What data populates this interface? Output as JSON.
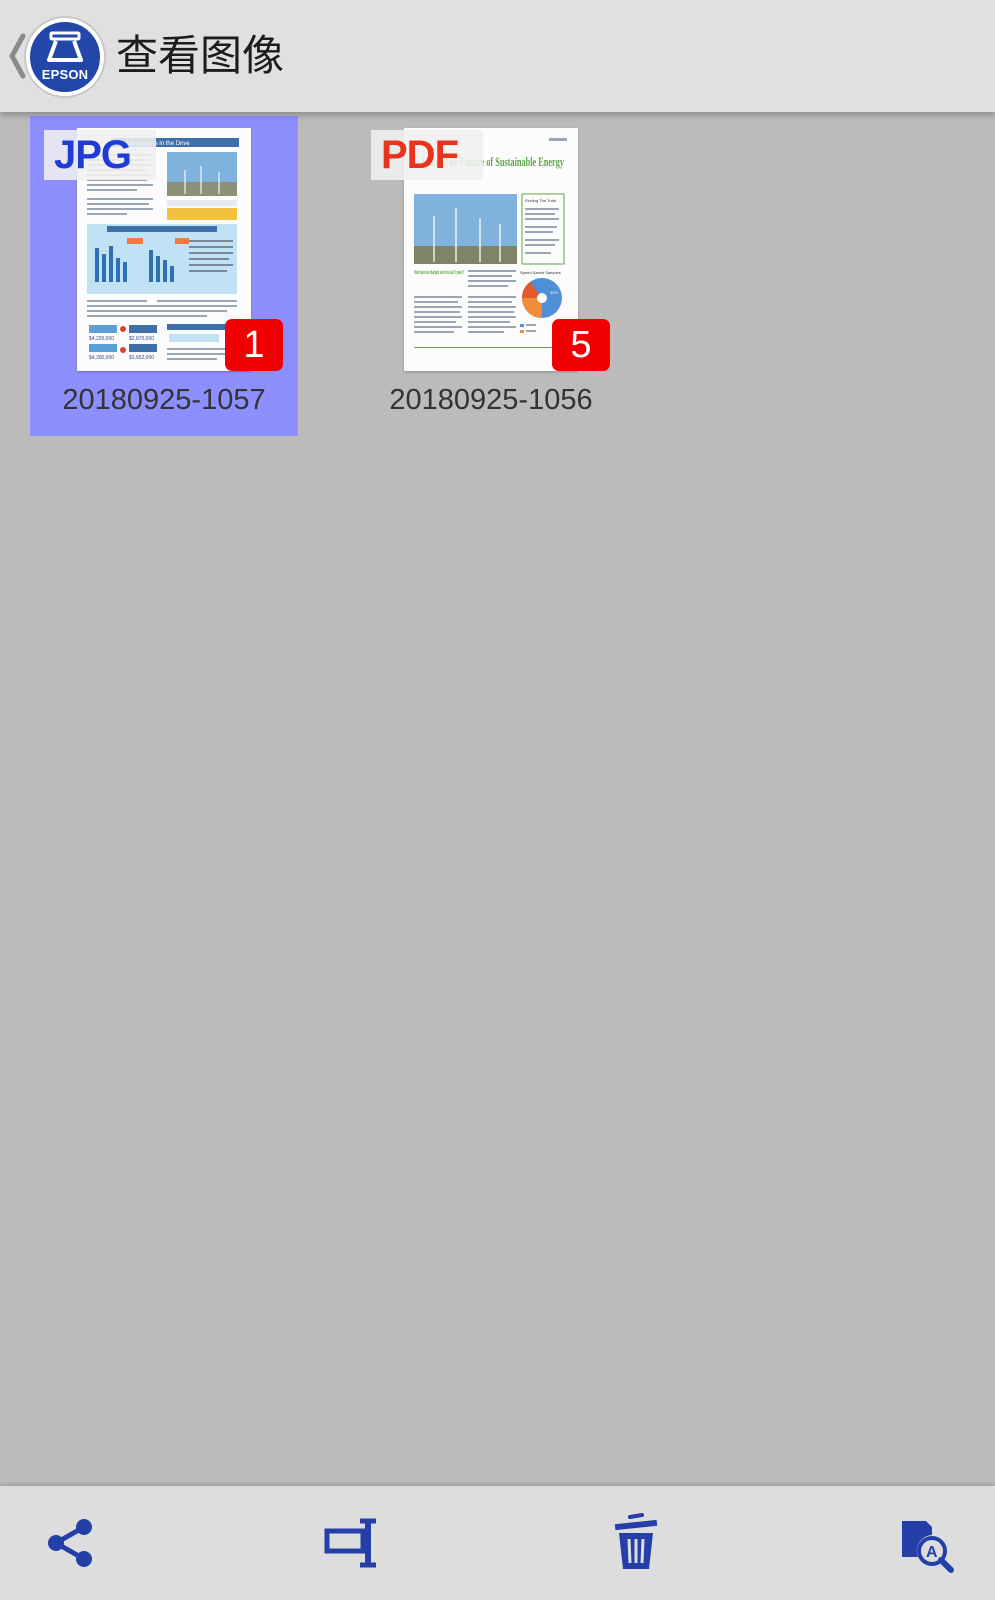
{
  "header": {
    "title": "查看图像",
    "logo_text": "EPSON",
    "back_icon": "chevron-left-icon"
  },
  "files": [
    {
      "name": "20180925-1057",
      "type": "JPG",
      "page_count": "1",
      "selected": true,
      "preview_title": "Global Leaders in the Drive",
      "preview_values": [
        "$4,220,000",
        "$2,870,000",
        "$4,300,000",
        "$3,652,000"
      ]
    },
    {
      "name": "20180925-1056",
      "type": "PDF",
      "page_count": "5",
      "selected": false,
      "preview_title": "Using The Future of Sustainable Energy",
      "preview_heading": "How have we changed over the last 5 years?",
      "preview_side_title": "Finding The Truth",
      "preview_chart_title": "Speed Saved Samples",
      "preview_pct": "32%"
    }
  ],
  "toolbar": {
    "icons": [
      "share-icon",
      "rename-icon",
      "delete-icon",
      "image-search-icon"
    ],
    "accent": "#2440a8"
  },
  "colors": {
    "jpg": "#1f3cd6",
    "pdf": "#e8341c",
    "selection": "#8e8ffe",
    "badge": "#f00000"
  }
}
